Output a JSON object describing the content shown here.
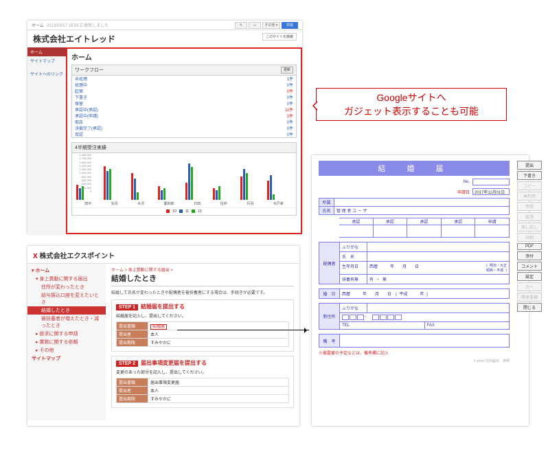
{
  "domain": "Computer-Use",
  "bubble": {
    "line1": "Googleサイトへ",
    "line2": "ガジェット表示することも可能"
  },
  "google_sites": {
    "crumb_home": "ホーム",
    "crumb_time": "2013/03/17 18:55 に更新しました",
    "share_btn": "共有",
    "more_btn": "その他 ▾",
    "site_title": "株式会社エイトレッド",
    "search_label": "このサイトを検索",
    "side": {
      "home": "ホーム",
      "sitemap": "サイトマップ",
      "recent": "サイトへのリンク"
    },
    "gadget_heading": "ホーム",
    "workflow": {
      "title": "ワークフロー",
      "update": "更新",
      "rows": [
        {
          "label": "未処理",
          "count": "1件"
        },
        {
          "label": "処理中",
          "count": "0件"
        },
        {
          "label": "起案",
          "count": "0件",
          "red": true
        },
        {
          "label": "下書き",
          "count": "0件"
        },
        {
          "label": "保留",
          "count": "0件"
        },
        {
          "label": "承認中(承認)",
          "count": "11件",
          "red": true
        },
        {
          "label": "承認中(申請)",
          "count": "3件",
          "red": true
        },
        {
          "label": "取戻",
          "count": "0件"
        },
        {
          "label": "決裁完了(承認)",
          "count": "0件"
        },
        {
          "label": "否認",
          "count": "0件"
        }
      ]
    },
    "chart_box_title": "4半期受注実績"
  },
  "chart_data": {
    "type": "bar",
    "title": "4半期受注実績",
    "ylabel": "",
    "ylim": [
      0,
      2000000
    ],
    "yticks": [
      0,
      200000,
      400000,
      600000,
      800000,
      1000000,
      1200000,
      1400000,
      1600000,
      1700000,
      2000000
    ],
    "categories": [
      "田中",
      "矢島",
      "木沢",
      "慶四郎",
      "日田",
      "佐仲",
      "丹羽",
      "木戸孝"
    ],
    "series": [
      {
        "name": "10",
        "color": "#d22",
        "values": [
          800000,
          1750000,
          1400000,
          700000,
          900000,
          600000,
          1200000,
          1000000
        ]
      },
      {
        "name": "11",
        "color": "#2a5db0",
        "values": [
          600000,
          1500000,
          1100000,
          500000,
          1900000,
          500000,
          1600000,
          1300000
        ]
      },
      {
        "name": "12",
        "color": "#2a2",
        "values": [
          700000,
          1600000,
          400000,
          600000,
          1700000,
          700000,
          1400000,
          300000
        ]
      }
    ]
  },
  "xpoint": {
    "logo_text": "株式会社エクスポイント",
    "side": {
      "home": "ホーム",
      "cat1": "身上異動に関する届出",
      "c1a": "住所が変わったとき",
      "c1b": "給与振込口座を変えたいとき",
      "c1c": "結婚したとき",
      "c1d": "被扶養者が増えたとき・減ったとき",
      "cat2": "欲求に関する申請",
      "cat3": "業務に関する依頼",
      "cat4": "その他",
      "sitemap": "サイトマップ"
    },
    "crumb": "ホーム > 身上異動に関する届出 >",
    "h2": "結婚したとき",
    "desc": "結婚して氏名が変わったときや配偶者を被扶養者にする場合は、手続きが必要です。",
    "step1": {
      "badge": "STEP 1",
      "title": "結婚届を提出する",
      "sub": "結婚届を記入し、提出してください。",
      "rows": [
        {
          "k": "提出書類",
          "v": "結婚届",
          "link": true
        },
        {
          "k": "提出者",
          "v": "本人"
        },
        {
          "k": "提出期限",
          "v": "すみやかに"
        }
      ]
    },
    "step2": {
      "badge": "STEP 2",
      "title": "届出事項変更届を提出する",
      "sub": "変更のあった部分を記入し、提出してください。",
      "rows": [
        {
          "k": "提出書類",
          "v": "届出事項変更届"
        },
        {
          "k": "提出者",
          "v": "本人"
        },
        {
          "k": "提出期限",
          "v": "すみやかに"
        }
      ]
    }
  },
  "form": {
    "title": "結　婚　届",
    "no_label": "No.",
    "no_value": "",
    "date_label": "申請日",
    "date_value": "2017年11月01日",
    "affil_k": "所属",
    "affil_v": "",
    "name_k": "氏名",
    "name_v": "管 理 者 ユ ー ザ",
    "approvals": [
      "承認",
      "承認",
      "承認",
      "承認",
      "申請"
    ],
    "spouse_section": "配偶者",
    "furigana": "ふりがな",
    "shimei": "氏　名",
    "birth_k": "生年月日",
    "birth_v": "西暦　　　年　　月　　日",
    "birth_era": "( 明治・大正\n昭和・平成 )",
    "dep_k": "扶養有無",
    "dep_v": "有 ・ 無",
    "mdate_k": "婚　日",
    "mdate_v": "西暦　　　年　　月　　日　( 平成　　　年 )",
    "addr_section": "新住所",
    "tel": "TEL",
    "fax": "FAX",
    "remarks_k": "備　考",
    "note": "※披露宴の予定などは、備考欄に記入",
    "footnote": "X-point  社内届出　参照"
  },
  "form_buttons": [
    {
      "label": "提出",
      "disabled": false
    },
    {
      "label": "下書き",
      "disabled": false
    },
    {
      "label": "コピー",
      "disabled": true
    },
    {
      "label": "再利用",
      "disabled": true
    },
    {
      "label": "参照",
      "disabled": true
    },
    {
      "label": "取消",
      "disabled": true
    },
    {
      "label": "差し戻し",
      "disabled": true
    },
    {
      "label": "印刷",
      "disabled": true
    },
    {
      "label": "PDF",
      "disabled": false
    },
    {
      "label": "添付",
      "disabled": false
    },
    {
      "label": "コメント",
      "disabled": false
    },
    {
      "label": "設定",
      "disabled": false
    },
    {
      "label": "次へ",
      "disabled": true
    },
    {
      "label": "関連書類",
      "disabled": true
    },
    {
      "label": "閉じる",
      "disabled": false
    }
  ]
}
